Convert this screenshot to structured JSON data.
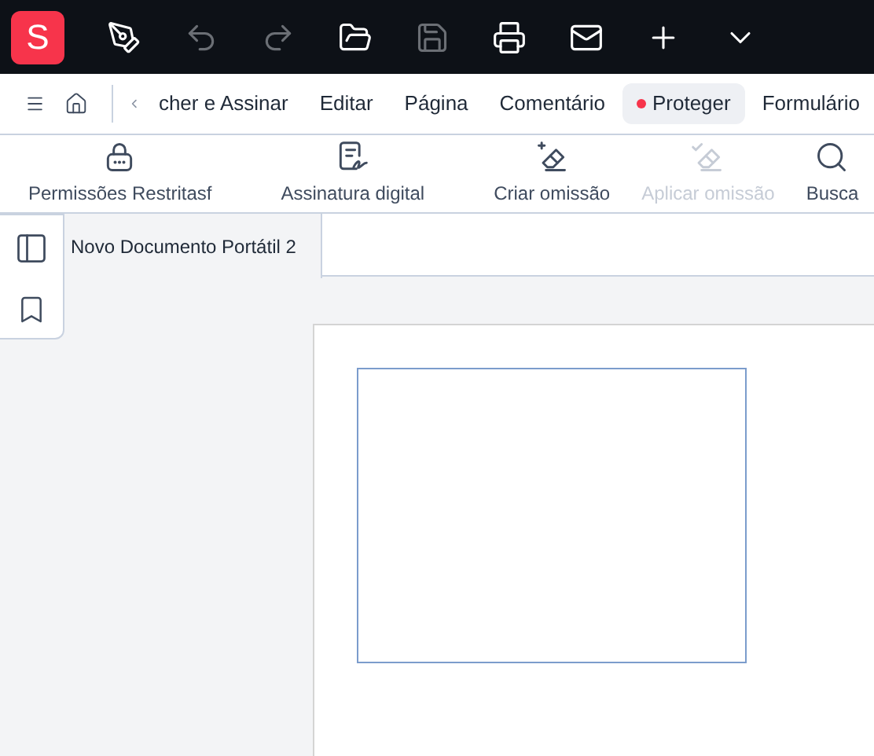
{
  "app_bar": {
    "logo": "S",
    "tools": [
      {
        "kind": "pen",
        "disabled": false
      },
      {
        "kind": "undo",
        "disabled": true
      },
      {
        "kind": "redo",
        "disabled": true
      },
      {
        "kind": "open",
        "disabled": false
      },
      {
        "kind": "save",
        "disabled": true
      },
      {
        "kind": "print",
        "disabled": false
      },
      {
        "kind": "mail",
        "disabled": false
      },
      {
        "kind": "add",
        "disabled": false
      },
      {
        "kind": "more",
        "disabled": false
      }
    ]
  },
  "menu_tabs": [
    {
      "label": "cher e Assinar",
      "selected": false
    },
    {
      "label": "Editar",
      "selected": false
    },
    {
      "label": "Página",
      "selected": false
    },
    {
      "label": "Comentário",
      "selected": false
    },
    {
      "label": "Proteger",
      "selected": true
    },
    {
      "label": "Formulário",
      "selected": false
    }
  ],
  "ribbon": [
    {
      "kind": "lock",
      "label": "Permissões Restritasf",
      "disabled": false
    },
    {
      "kind": "signature",
      "label": "Assinatura digital",
      "disabled": false
    },
    {
      "kind": "eraser",
      "label": "Criar omissão",
      "disabled": false
    },
    {
      "kind": "eraser-check",
      "label": "Aplicar omissão",
      "disabled": true
    },
    {
      "kind": "search",
      "label": "Busca",
      "disabled": false
    }
  ],
  "document_tab": {
    "title": "Novo Documento Portátil 2"
  }
}
